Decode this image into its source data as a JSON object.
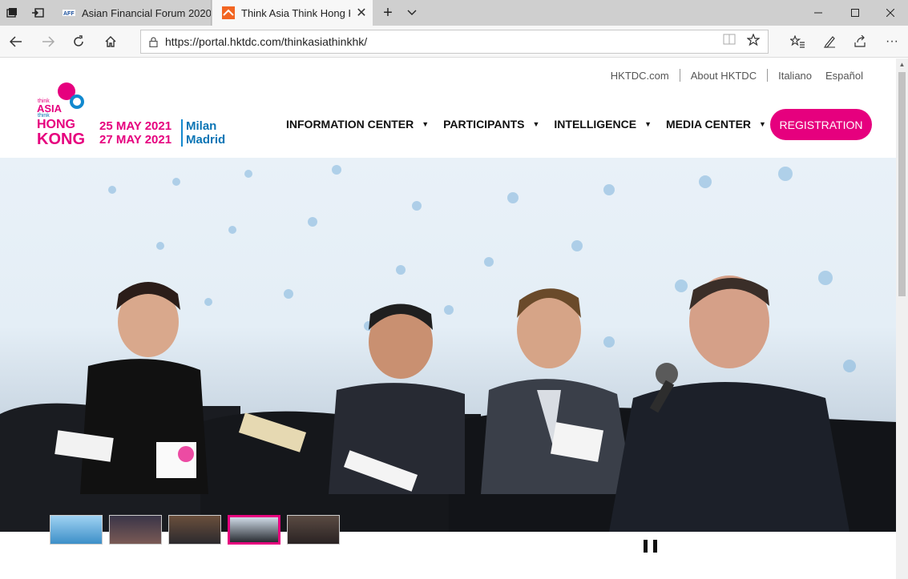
{
  "browser": {
    "tabs": [
      {
        "title": "Asian Financial Forum 2020",
        "active": false
      },
      {
        "title": "Think Asia Think Hong Kong",
        "active": true
      }
    ],
    "url": "https://portal.hktdc.com/thinkasiathinkhk/"
  },
  "header": {
    "top_links": [
      "HKTDC.com",
      "About HKTDC",
      "Italiano",
      "Español"
    ],
    "logo": {
      "think": "think",
      "asia": "ASIA",
      "think2": "think",
      "hong": "HONG",
      "kong": "KONG"
    },
    "events": [
      {
        "date": "25 MAY 2021",
        "city": "Milan"
      },
      {
        "date": "27 MAY 2021",
        "city": "Madrid"
      }
    ],
    "nav": [
      "INFORMATION CENTER",
      "PARTICIPANTS",
      "INTELLIGENCE",
      "MEDIA CENTER"
    ],
    "registration_label": "REGISTRATION"
  },
  "hero": {
    "active_thumb_index": 3,
    "thumb_count": 5
  },
  "colors": {
    "brand_pink": "#e6007e",
    "brand_blue": "#0a75b5"
  }
}
